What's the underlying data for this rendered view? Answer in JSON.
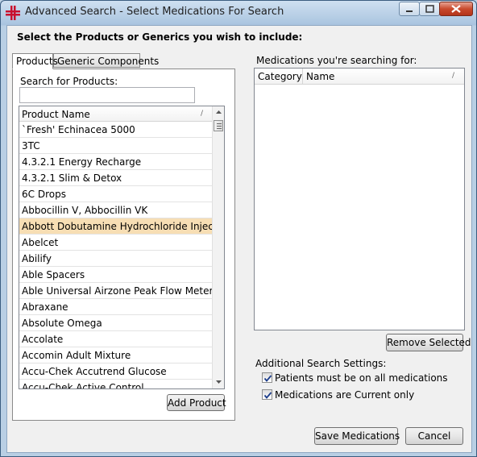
{
  "window": {
    "title": "Advanced Search - Select Medications For Search",
    "icon": "red-cross-app-icon",
    "controls": [
      "minimize-icon",
      "maximize-icon",
      "close-icon"
    ]
  },
  "heading": "Select the Products or Generics you wish to include:",
  "tabs": [
    {
      "label": "Products",
      "active": true
    },
    {
      "label": "Generic Components",
      "active": false
    }
  ],
  "products": {
    "search_label": "Search for Products:",
    "search_value": "",
    "column_header": "Product Name",
    "items": [
      "`Fresh' Echinacea 5000",
      "3TC",
      "4.3.2.1 Energy Recharge",
      "4.3.2.1 Slim & Detox",
      "6C Drops",
      "Abbocillin V, Abbocillin VK",
      "Abbott Dobutamine Hydrochloride Injection",
      "Abelcet",
      "Abilify",
      "Able Spacers",
      "Able Universal Airzone Peak Flow Meter",
      "Abraxane",
      "Absolute Omega",
      "Accolate",
      "Accomin Adult Mixture",
      "Accu-Chek Accutrend Glucose",
      "Accu-Chek Active Control"
    ],
    "selected_item": "Abbott Dobutamine Hydrochloride Injection",
    "add_button": "Add Product"
  },
  "searching": {
    "label": "Medications you're searching for:",
    "columns": [
      "Category",
      "Name"
    ],
    "remove_button": "Remove Selected"
  },
  "settings": {
    "label": "Additional Search Settings:",
    "options": [
      {
        "label": "Patients must be on all medications",
        "checked": true
      },
      {
        "label": "Medications are Current only",
        "checked": true
      }
    ]
  },
  "footer": {
    "save_button": "Save Medications",
    "cancel_button": "Cancel"
  },
  "colors": {
    "selected_row": "#f7deb4",
    "client_bg": "#f0f0f0",
    "title_bar": "#bfd3e6",
    "close_button": "#c94a2d"
  }
}
